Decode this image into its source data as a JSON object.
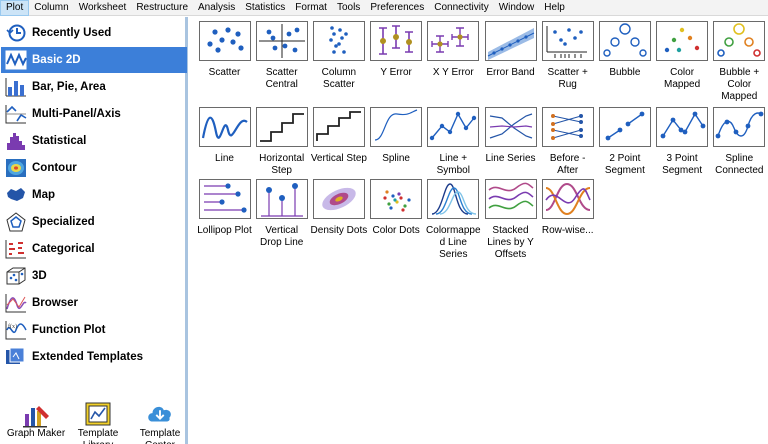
{
  "menu": [
    "Plot",
    "Column",
    "Worksheet",
    "Restructure",
    "Analysis",
    "Statistics",
    "Format",
    "Tools",
    "Preferences",
    "Connectivity",
    "Window",
    "Help"
  ],
  "categories": [
    {
      "label": "Recently Used",
      "icon": "clock-icon",
      "color": "#1f5fbf"
    },
    {
      "label": "Basic 2D",
      "icon": "line-wave-icon",
      "color": "#1f5fbf"
    },
    {
      "label": "Bar, Pie, Area",
      "icon": "bar-chart-icon",
      "color": "#2455a8"
    },
    {
      "label": "Multi-Panel/Axis",
      "icon": "multi-panel-icon",
      "color": "#2455a8"
    },
    {
      "label": "Statistical",
      "icon": "histogram-icon",
      "color": "#7a3bb0"
    },
    {
      "label": "Contour",
      "icon": "contour-icon",
      "color": "#2a6fbf"
    },
    {
      "label": "Map",
      "icon": "map-icon",
      "color": "#2455a8"
    },
    {
      "label": "Specialized",
      "icon": "radar-icon",
      "color": "#2455a8"
    },
    {
      "label": "Categorical",
      "icon": "categorical-icon",
      "color": "#d03030"
    },
    {
      "label": "3D",
      "icon": "cube-scatter-icon",
      "color": "#2455a8"
    },
    {
      "label": "Browser",
      "icon": "browser-icon",
      "color": "#8a4fb8"
    },
    {
      "label": "Function Plot",
      "icon": "function-icon",
      "color": "#2455a8"
    },
    {
      "label": "Extended Templates",
      "icon": "templates-icon",
      "color": "#2455a8"
    }
  ],
  "selected_category": "Basic 2D",
  "bottom_tools": [
    {
      "label": "Graph Maker",
      "icon": "graph-maker-icon"
    },
    {
      "label": "Template Library",
      "icon": "template-library-icon"
    },
    {
      "label": "Template Center",
      "icon": "cloud-download-icon"
    }
  ],
  "plot_types": [
    {
      "label": "Scatter",
      "icon": "scatter-icon"
    },
    {
      "label": "Scatter Central",
      "icon": "scatter-central-icon"
    },
    {
      "label": "Column Scatter",
      "icon": "column-scatter-icon"
    },
    {
      "label": "Y Error",
      "icon": "y-error-icon"
    },
    {
      "label": "X Y Error",
      "icon": "xy-error-icon"
    },
    {
      "label": "Error Band",
      "icon": "error-band-icon"
    },
    {
      "label": "Scatter + Rug",
      "icon": "scatter-rug-icon"
    },
    {
      "label": "Bubble",
      "icon": "bubble-icon"
    },
    {
      "label": "Color Mapped",
      "icon": "color-mapped-icon"
    },
    {
      "label": "Bubble + Color Mapped",
      "icon": "bubble-color-mapped-icon"
    },
    {
      "label": "Line",
      "icon": "line-icon"
    },
    {
      "label": "Horizontal Step",
      "icon": "horizontal-step-icon"
    },
    {
      "label": "Vertical Step",
      "icon": "vertical-step-icon"
    },
    {
      "label": "Spline",
      "icon": "spline-icon"
    },
    {
      "label": "Line + Symbol",
      "icon": "line-symbol-icon"
    },
    {
      "label": "Line Series",
      "icon": "line-series-icon"
    },
    {
      "label": "Before - After",
      "icon": "before-after-icon"
    },
    {
      "label": "2 Point Segment",
      "icon": "two-point-segment-icon"
    },
    {
      "label": "3 Point Segment",
      "icon": "three-point-segment-icon"
    },
    {
      "label": "Spline Connected",
      "icon": "spline-connected-icon"
    },
    {
      "label": "Lollipop Plot",
      "icon": "lollipop-icon"
    },
    {
      "label": "Vertical Drop Line",
      "icon": "vertical-drop-line-icon"
    },
    {
      "label": "Density Dots",
      "icon": "density-dots-icon"
    },
    {
      "label": "Color Dots",
      "icon": "color-dots-icon"
    },
    {
      "label": "Colormapped Line Series",
      "icon": "colormapped-line-series-icon"
    },
    {
      "label": "Stacked Lines by Y Offsets",
      "icon": "stacked-lines-icon"
    },
    {
      "label": "Row-wise...",
      "icon": "row-wise-icon"
    }
  ]
}
